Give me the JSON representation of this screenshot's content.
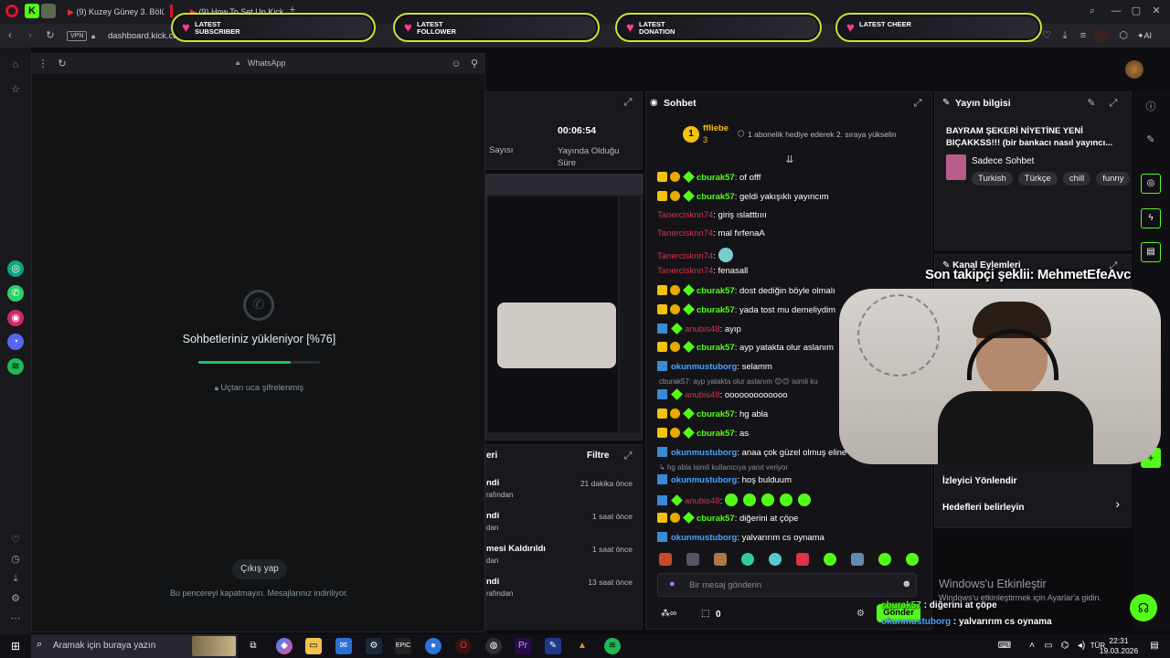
{
  "browser": {
    "tabs": [
      "(9) Kuzey Güney 3. Bölüm",
      "(9) How To Set Up Kick Lo"
    ],
    "vpn": "VPN",
    "url": "dashboard.kick.com"
  },
  "alerts": [
    "LATEST SUBSCRIBER",
    "LATEST FOLLOWER",
    "LATEST DONATION",
    "LATEST CHEER"
  ],
  "whatsapp": {
    "title": "WhatsApp",
    "loading_text": "Sohbetleriniz yükleniyor [%76]",
    "progress": 0.76,
    "encrypted": "Uçtan uca şifrelenmiş",
    "logout": "Çıkış yap",
    "footer": "Bu pencereyi kapatmayın. Mesajlarınız indiriliyor."
  },
  "stats": {
    "viewers_label": "Sayısı",
    "duration_value": "00:06:54",
    "duration_label": "Yayında Olduğu Süre"
  },
  "activity": {
    "title_fragment": "eri",
    "filter": "Filtre",
    "rows": [
      {
        "title": "ndi",
        "sub": "rafından",
        "time": "21 dakika önce"
      },
      {
        "title": "ndi",
        "sub": "dan",
        "time": "1 saat önce"
      },
      {
        "title": "mesi Kaldırıldı",
        "sub": "dan",
        "time": "1 saat önce"
      },
      {
        "title": "ndi",
        "sub": "rafından",
        "time": "13 saat önce"
      }
    ]
  },
  "chat": {
    "title": "Sohbet",
    "pinned_user": "ffliebe",
    "pinned_count": "3",
    "pinned_text": "1 abonelik hediye ederek 2. sıraya yükselin",
    "messages": [
      {
        "user": "cburak57",
        "text": ": of offf",
        "kind": "g"
      },
      {
        "user": "cburak57",
        "text": ": geldi yakışıklı yayıncım",
        "kind": "g"
      },
      {
        "user": "Tanercisknn74",
        "text": ": giriş ıslatttıııı",
        "kind": "r"
      },
      {
        "user": "Tanercisknn74",
        "text": ": mal fırfenaA",
        "kind": "r"
      },
      {
        "user": "Tanercisknn74",
        "text": ":",
        "kind": "r"
      },
      {
        "user": "Tanercisknn74",
        "text": ": fenasall",
        "kind": "r"
      },
      {
        "user": "cburak57",
        "text": ": dost dediğin böyle olmalı",
        "kind": "g"
      },
      {
        "user": "cburak57",
        "text": ": yada tost mu demeliydim",
        "kind": "g"
      },
      {
        "user": "anubis48",
        "text": ": ayıp",
        "kind": "r"
      },
      {
        "user": "cburak57",
        "text": ": ayp yatakta olur aslanım",
        "kind": "g"
      },
      {
        "user": "okunmustuborg",
        "text": ": selamm",
        "kind": "b"
      },
      {
        "user": "anubis48",
        "text": ": ooooooooooooo",
        "kind": "r"
      },
      {
        "user": "cburak57",
        "text": ": hg abla",
        "kind": "g"
      },
      {
        "user": "cburak57",
        "text": ": as",
        "kind": "g"
      },
      {
        "user": "okunmustuborg",
        "text": ": anaa çok güzel olmuş eline",
        "kind": "b"
      },
      {
        "user": "okunmustuborg",
        "text": ": hoş bulduum",
        "kind": "b"
      },
      {
        "user": "anubis48",
        "text": ":",
        "kind": "r"
      },
      {
        "user": "cburak57",
        "text": ": diğerini at çöpe",
        "kind": "g"
      },
      {
        "user": "okunmustuborg",
        "text": ": yalvarırım cs oynama",
        "kind": "b"
      }
    ],
    "reply1": "cburak57: ayp yatakta olur aslanım",
    "reply1_tail": "isimli ku",
    "reply2": "hg abla isimli kullanıcıya yanıt veriyor",
    "placeholder": "Bir mesaj gönderin",
    "gift_count": "0",
    "send": "Gönder"
  },
  "stream_info": {
    "title": "Yayın bilgisi",
    "stream_title": "BAYRAM ŞEKERİ NİYETİNE YENİ BIÇAKKSS!!! (bir bankacı nasıl yayıncı...",
    "category": "Sadece Sohbet",
    "tags": [
      "Turkish",
      "Türkçe",
      "chill",
      "funny"
    ]
  },
  "channel_actions": {
    "title": "Kanal Eylemleri",
    "redirect": "İzleyici Yönlendir",
    "goals": "Hedefleri belirleyin"
  },
  "overlay": {
    "last_follower": "Son takipçi şeklii: MehmetEfeAvc",
    "ticker": [
      {
        "user": "cburak57",
        "text": " : diğerini at çöpe"
      },
      {
        "user": "okunmustuborg",
        "text": " : yalvarırım cs oynama"
      }
    ]
  },
  "windows": {
    "activate_title": "Windows'u Etkinleştir",
    "activate_sub": "Windows'u etkinleştirmek için Ayarlar'a gidin.",
    "search": "Aramak için buraya yazın",
    "time": "22:31",
    "date": "19.03.2026"
  },
  "colors": {
    "kick_green": "#53fc18",
    "alert_border": "#c7e630",
    "danger": "#d3314f"
  }
}
